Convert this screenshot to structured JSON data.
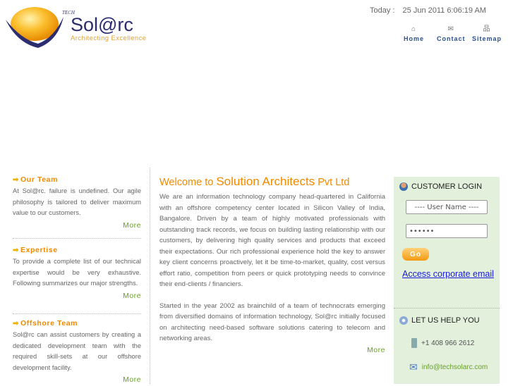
{
  "header": {
    "logo": {
      "brand": "Sol@rc",
      "prefix": "TECH",
      "tagline": "Architecting Excellence"
    },
    "today_label": "Today :",
    "today_value": "25 Jun 2011 6:06:19 AM",
    "nav": [
      {
        "label": "Home",
        "icon": "home-icon",
        "glyph": "⌂"
      },
      {
        "label": "Contact",
        "icon": "mail-icon",
        "glyph": "✉"
      },
      {
        "label": "Sitemap",
        "icon": "sitemap-icon",
        "glyph": "品"
      }
    ]
  },
  "left": [
    {
      "title": "Our Team",
      "text": "At Sol@rc. failure is undefined. Our agile philosophy is tailored to deliver maximum value to our customers.",
      "more": "More"
    },
    {
      "title": "Expertise",
      "text": "To provide a complete list of our technical expertise would be very exhaustive. Following summarizes our major strengths.",
      "more": "More"
    },
    {
      "title": "Offshore Team",
      "text": "Sol@rc can assist customers by creating a dedicated development team with the required skill-sets at our offshore development facility.",
      "more": "More"
    }
  ],
  "main": {
    "title_a": "Welcome to ",
    "title_b": "Solution Architects",
    "title_c": " Pvt Ltd",
    "paragraphs": [
      "We are an information technology company head-quartered in California with an offshore competency center located in Silicon Valley of India, Bangalore. Driven by a team of highly motivated professionals with outstanding track records, we focus on building lasting relationship with our customers, by delivering high quality services and products that exceed their expectations. Our rich professional experience hold the key to answer key client concerns proactively, let it be time-to-market, quality, cost versus effort ratio, competition from peers or quick prototyping needs to convince their end-clients / financiers.",
      "Started in the year 2002 as brainchild of a team of technocrats emerging from diversified domains of information technology, Sol@rc initially focused on architecting need-based software solutions catering to telecom and networking areas."
    ],
    "more": "More"
  },
  "login": {
    "title": "CUSTOMER LOGIN",
    "username_value": "---- User Name ----",
    "password_value": "******",
    "go": "Go",
    "corp_link": "Access corporate email"
  },
  "help": {
    "title": "LET US HELP YOU",
    "phone": "+1 408 966 2612",
    "email": "info@techsolarc.com"
  },
  "colors": {
    "accent": "#f08a00",
    "link_green": "#6b9e2e",
    "panel_bg": "#e2f0dc",
    "nav_blue": "#2a4f8a"
  }
}
